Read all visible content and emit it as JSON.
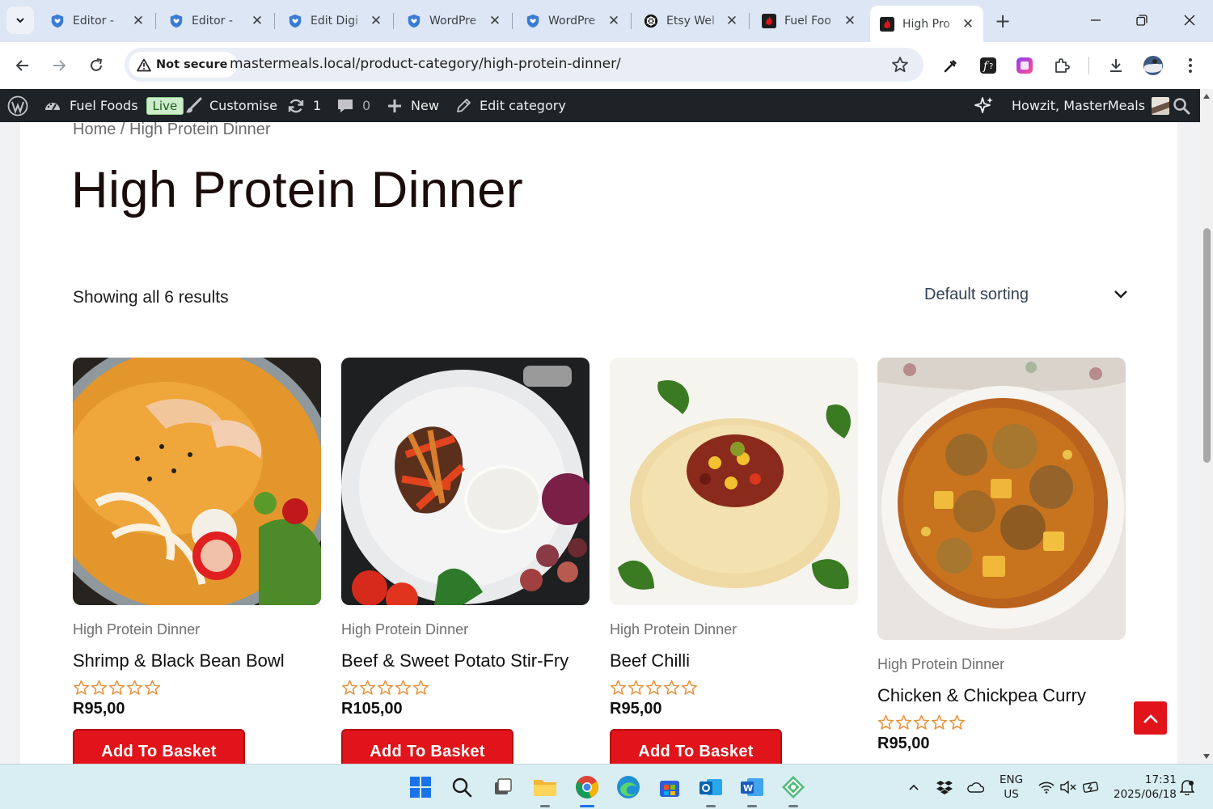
{
  "browser": {
    "tabs": [
      {
        "title": "Editor - ",
        "icon": "wordpress-shield-icon"
      },
      {
        "title": "Editor - ",
        "icon": "wordpress-shield-icon"
      },
      {
        "title": "Edit Digi",
        "icon": "wordpress-shield-icon"
      },
      {
        "title": "WordPre",
        "icon": "wordpress-shield-icon"
      },
      {
        "title": "WordPre",
        "icon": "wordpress-shield-icon"
      },
      {
        "title": "Etsy Wel",
        "icon": "openai-icon"
      },
      {
        "title": "Fuel Foo",
        "icon": "flame-icon"
      },
      {
        "title": "High Pro",
        "icon": "flame-icon",
        "active": true
      }
    ],
    "security_label": "Not secure",
    "url": "mastermeals.local/product-category/high-protein-dinner/"
  },
  "adminbar": {
    "site_name": "Fuel Foods",
    "live_badge": "Live",
    "customise": "Customise",
    "updates_count": "1",
    "comments_count": "0",
    "new": "New",
    "edit_category": "Edit category",
    "greeting": "Howzit, MasterMeals"
  },
  "page": {
    "breadcrumb": "Home / High Protein Dinner",
    "title": "High Protein Dinner",
    "result_count": "Showing all 6 results",
    "sorting": "Default sorting",
    "add_to_basket": "Add To Basket"
  },
  "products": [
    {
      "category": "High Protein Dinner",
      "name": "Shrimp & Black Bean Bowl",
      "price": "R95,00",
      "rating": 0
    },
    {
      "category": "High Protein Dinner",
      "name": "Beef & Sweet Potato Stir-Fry",
      "price": "R105,00",
      "rating": 0
    },
    {
      "category": "High Protein Dinner",
      "name": "Beef Chilli",
      "price": "R95,00",
      "rating": 0
    },
    {
      "category": "High Protein Dinner",
      "name": "Chicken & Chickpea Curry",
      "price": "R95,00",
      "rating": 0
    }
  ],
  "taskbar": {
    "language": "ENG",
    "region": "US",
    "time": "17:31",
    "date": "2025/06/18"
  },
  "colors": {
    "accent_red": "#e0141a",
    "admin_bar": "#1d2327",
    "star_outline": "#e8923a"
  }
}
